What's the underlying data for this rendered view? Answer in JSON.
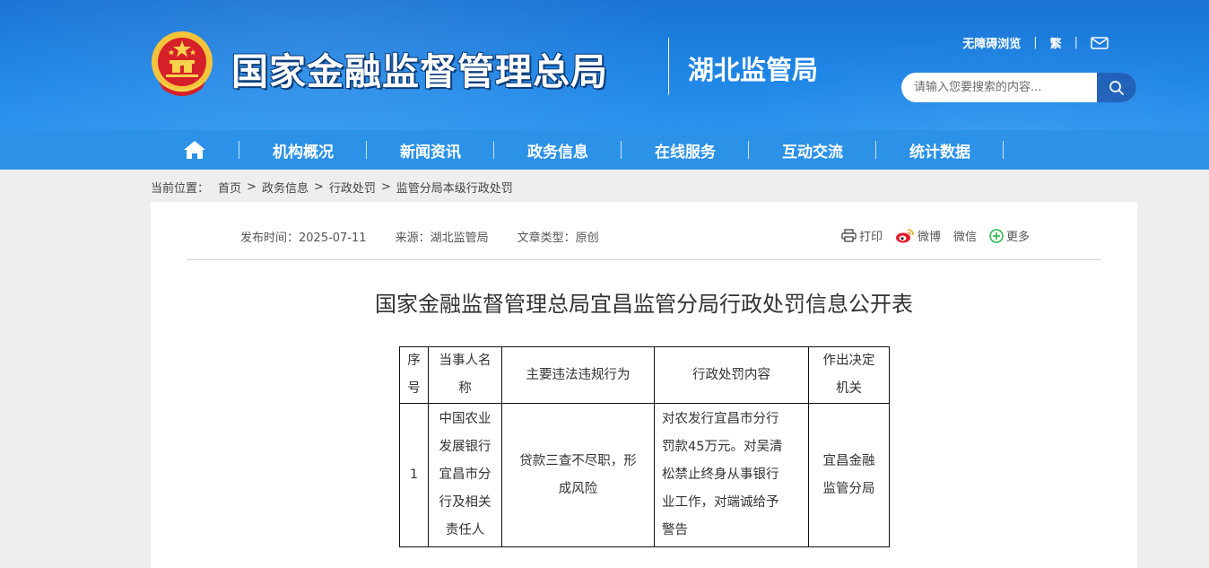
{
  "header": {
    "site_title": "国家金融监督管理总局",
    "bureau_name": "湖北监管局",
    "links": {
      "accessible": "无障碍浏览",
      "traditional": "繁"
    },
    "search_placeholder": "请输入您要搜索的内容..."
  },
  "nav": {
    "items": [
      {
        "label": "机构概况"
      },
      {
        "label": "新闻资讯"
      },
      {
        "label": "政务信息"
      },
      {
        "label": "在线服务"
      },
      {
        "label": "互动交流"
      },
      {
        "label": "统计数据"
      }
    ]
  },
  "breadcrumb": {
    "prefix": "当前位置：",
    "items": [
      "首页",
      "政务信息",
      "行政处罚",
      "监管分局本级行政处罚"
    ],
    "separator": ">"
  },
  "article": {
    "publish_time": "发布时间：2025-07-11",
    "source": "来源：湖北监管局",
    "type": "文章类型：原创",
    "share": {
      "print": "打印",
      "weibo": "微博",
      "wechat": "微信",
      "more": "更多"
    },
    "title": "国家金融监督管理总局宜昌监管分局行政处罚信息公开表"
  },
  "table": {
    "headers": {
      "no": [
        "序",
        "号"
      ],
      "party": [
        "当事人名",
        "称"
      ],
      "violation": "主要违法违规行为",
      "penalty": "行政处罚内容",
      "authority": [
        "作出决定",
        "机关"
      ]
    },
    "rows": [
      {
        "no": "1",
        "party": [
          "中国农业",
          "发展银行",
          "宜昌市分",
          "行及相关",
          "责任人"
        ],
        "violation": [
          "贷款三查不尽职，形",
          "成风险"
        ],
        "penalty": [
          "对农发行宜昌市分行",
          "罚款45万元。对吴清",
          "松禁止终身从事银行",
          "业工作，对端诚给予",
          "警告"
        ],
        "authority": [
          "宜昌金融",
          "监管分局"
        ]
      }
    ]
  },
  "colors": {
    "header_blue": "#1f86e6",
    "nav_blue": "#2c92e8",
    "search_button": "#1c5fb8",
    "page_bg": "#eeeeee"
  }
}
